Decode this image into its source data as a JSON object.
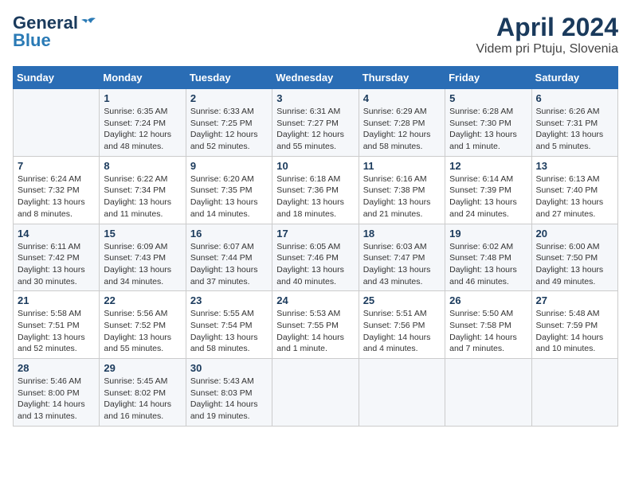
{
  "header": {
    "logo_line1": "General",
    "logo_line2": "Blue",
    "month": "April 2024",
    "location": "Videm pri Ptuju, Slovenia"
  },
  "weekdays": [
    "Sunday",
    "Monday",
    "Tuesday",
    "Wednesday",
    "Thursday",
    "Friday",
    "Saturday"
  ],
  "weeks": [
    [
      {
        "day": "",
        "info": ""
      },
      {
        "day": "1",
        "info": "Sunrise: 6:35 AM\nSunset: 7:24 PM\nDaylight: 12 hours\nand 48 minutes."
      },
      {
        "day": "2",
        "info": "Sunrise: 6:33 AM\nSunset: 7:25 PM\nDaylight: 12 hours\nand 52 minutes."
      },
      {
        "day": "3",
        "info": "Sunrise: 6:31 AM\nSunset: 7:27 PM\nDaylight: 12 hours\nand 55 minutes."
      },
      {
        "day": "4",
        "info": "Sunrise: 6:29 AM\nSunset: 7:28 PM\nDaylight: 12 hours\nand 58 minutes."
      },
      {
        "day": "5",
        "info": "Sunrise: 6:28 AM\nSunset: 7:30 PM\nDaylight: 13 hours\nand 1 minute."
      },
      {
        "day": "6",
        "info": "Sunrise: 6:26 AM\nSunset: 7:31 PM\nDaylight: 13 hours\nand 5 minutes."
      }
    ],
    [
      {
        "day": "7",
        "info": "Sunrise: 6:24 AM\nSunset: 7:32 PM\nDaylight: 13 hours\nand 8 minutes."
      },
      {
        "day": "8",
        "info": "Sunrise: 6:22 AM\nSunset: 7:34 PM\nDaylight: 13 hours\nand 11 minutes."
      },
      {
        "day": "9",
        "info": "Sunrise: 6:20 AM\nSunset: 7:35 PM\nDaylight: 13 hours\nand 14 minutes."
      },
      {
        "day": "10",
        "info": "Sunrise: 6:18 AM\nSunset: 7:36 PM\nDaylight: 13 hours\nand 18 minutes."
      },
      {
        "day": "11",
        "info": "Sunrise: 6:16 AM\nSunset: 7:38 PM\nDaylight: 13 hours\nand 21 minutes."
      },
      {
        "day": "12",
        "info": "Sunrise: 6:14 AM\nSunset: 7:39 PM\nDaylight: 13 hours\nand 24 minutes."
      },
      {
        "day": "13",
        "info": "Sunrise: 6:13 AM\nSunset: 7:40 PM\nDaylight: 13 hours\nand 27 minutes."
      }
    ],
    [
      {
        "day": "14",
        "info": "Sunrise: 6:11 AM\nSunset: 7:42 PM\nDaylight: 13 hours\nand 30 minutes."
      },
      {
        "day": "15",
        "info": "Sunrise: 6:09 AM\nSunset: 7:43 PM\nDaylight: 13 hours\nand 34 minutes."
      },
      {
        "day": "16",
        "info": "Sunrise: 6:07 AM\nSunset: 7:44 PM\nDaylight: 13 hours\nand 37 minutes."
      },
      {
        "day": "17",
        "info": "Sunrise: 6:05 AM\nSunset: 7:46 PM\nDaylight: 13 hours\nand 40 minutes."
      },
      {
        "day": "18",
        "info": "Sunrise: 6:03 AM\nSunset: 7:47 PM\nDaylight: 13 hours\nand 43 minutes."
      },
      {
        "day": "19",
        "info": "Sunrise: 6:02 AM\nSunset: 7:48 PM\nDaylight: 13 hours\nand 46 minutes."
      },
      {
        "day": "20",
        "info": "Sunrise: 6:00 AM\nSunset: 7:50 PM\nDaylight: 13 hours\nand 49 minutes."
      }
    ],
    [
      {
        "day": "21",
        "info": "Sunrise: 5:58 AM\nSunset: 7:51 PM\nDaylight: 13 hours\nand 52 minutes."
      },
      {
        "day": "22",
        "info": "Sunrise: 5:56 AM\nSunset: 7:52 PM\nDaylight: 13 hours\nand 55 minutes."
      },
      {
        "day": "23",
        "info": "Sunrise: 5:55 AM\nSunset: 7:54 PM\nDaylight: 13 hours\nand 58 minutes."
      },
      {
        "day": "24",
        "info": "Sunrise: 5:53 AM\nSunset: 7:55 PM\nDaylight: 14 hours\nand 1 minute."
      },
      {
        "day": "25",
        "info": "Sunrise: 5:51 AM\nSunset: 7:56 PM\nDaylight: 14 hours\nand 4 minutes."
      },
      {
        "day": "26",
        "info": "Sunrise: 5:50 AM\nSunset: 7:58 PM\nDaylight: 14 hours\nand 7 minutes."
      },
      {
        "day": "27",
        "info": "Sunrise: 5:48 AM\nSunset: 7:59 PM\nDaylight: 14 hours\nand 10 minutes."
      }
    ],
    [
      {
        "day": "28",
        "info": "Sunrise: 5:46 AM\nSunset: 8:00 PM\nDaylight: 14 hours\nand 13 minutes."
      },
      {
        "day": "29",
        "info": "Sunrise: 5:45 AM\nSunset: 8:02 PM\nDaylight: 14 hours\nand 16 minutes."
      },
      {
        "day": "30",
        "info": "Sunrise: 5:43 AM\nSunset: 8:03 PM\nDaylight: 14 hours\nand 19 minutes."
      },
      {
        "day": "",
        "info": ""
      },
      {
        "day": "",
        "info": ""
      },
      {
        "day": "",
        "info": ""
      },
      {
        "day": "",
        "info": ""
      }
    ]
  ]
}
